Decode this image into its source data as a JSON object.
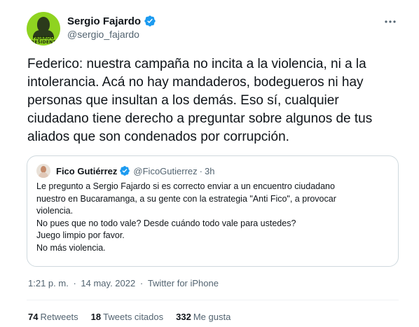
{
  "author": {
    "display_name": "Sergio Fajardo",
    "handle": "@sergio_fajardo",
    "avatar_mark": "FAJARDO PRESIDENTE",
    "verified": true
  },
  "tweet": {
    "text": "Federico: nuestra campaña no incita a la violencia, ni a la intolerancia. Acá no hay mandaderos, bodegueros ni hay personas que insultan a los demás. Eso sí, cualquier ciudadano tiene derecho a preguntar sobre algunos de tus aliados que son condenados por corrupción."
  },
  "quoted": {
    "display_name": "Fico Gutiérrez",
    "handle": "@FicoGutierrez",
    "separator": "·",
    "time": "3h",
    "verified": true,
    "lines": [
      "Le pregunto a Sergio Fajardo si es correcto enviar a un encuentro ciudadano",
      "nuestro en Bucaramanga, a su gente con la estrategia \"Anti Fico\", a provocar",
      "violencia.",
      "No pues que no todo vale? Desde cuándo todo vale para ustedes?",
      "Juego limpio por favor.",
      "No más violencia."
    ]
  },
  "meta": {
    "time": "1:21 p. m.",
    "separator": "·",
    "date": "14 may. 2022",
    "source": "Twitter for iPhone"
  },
  "stats": {
    "retweets_count": "74",
    "retweets_label": "Retweets",
    "quotes_count": "18",
    "quotes_label": "Tweets citados",
    "likes_count": "332",
    "likes_label": "Me gusta"
  },
  "colors": {
    "verified_blue": "#1d9bf0",
    "secondary_text": "#536471",
    "primary_text": "#0f1419",
    "avatar_green": "#8fd321"
  },
  "icons": {
    "verified": "verified-badge-icon",
    "more": "more-options-icon"
  }
}
